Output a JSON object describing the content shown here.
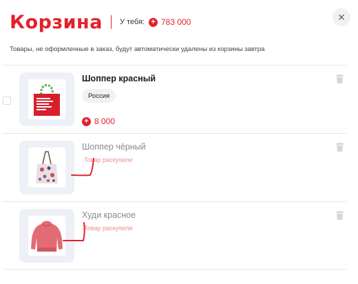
{
  "header": {
    "title": "Корзина",
    "balance_label": "У тебя:",
    "currency_symbol": "+",
    "balance_value": "783 000",
    "close_symbol": "✕"
  },
  "notice": "Товары, не оформленные в заказ, будут автоматически удалены из корзины завтра",
  "items": [
    {
      "name": "Шоппер красный",
      "tag": "Россия",
      "price": "8 000",
      "available": true
    },
    {
      "name": "Шоппер чёрный",
      "status": "Товар раскупили",
      "available": false
    },
    {
      "name": "Худи красное",
      "status": "Товар раскупили",
      "available": false
    }
  ],
  "colors": {
    "accent": "#e4202c",
    "soldout": "#f08a8a",
    "thumb_bg": "#eef0f7"
  },
  "icons": {
    "delete": "trash-icon",
    "close": "close-icon",
    "coin": "coin-icon"
  }
}
